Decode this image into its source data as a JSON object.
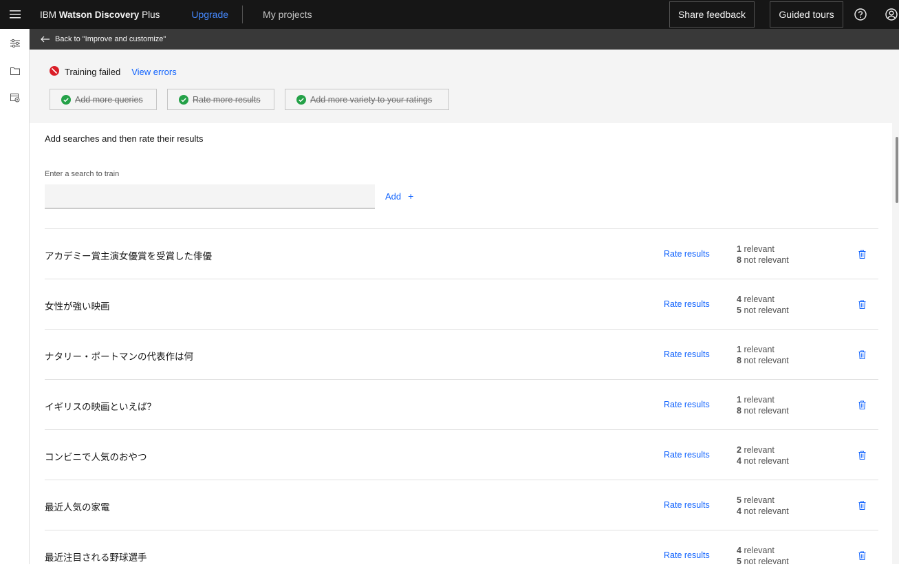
{
  "header": {
    "brand_regular": "IBM ",
    "brand_bold": "Watson Discovery",
    "brand_suffix": " Plus",
    "upgrade": "Upgrade",
    "my_projects": "My projects",
    "share_feedback": "Share feedback",
    "guided_tours": "Guided tours"
  },
  "back_link": "Back to \"Improve and customize\"",
  "status": {
    "label": "Training failed",
    "view_errors": "View errors",
    "color": "#da1e28",
    "tasks": [
      "Add more queries",
      "Rate more results",
      "Add more variety to your ratings"
    ],
    "task_check_color": "#24a148"
  },
  "main": {
    "title": "Add searches and then rate their results",
    "search_label": "Enter a search to train",
    "search_value": "",
    "add_label": "Add",
    "add_symbol": "+",
    "rate_label": "Rate results",
    "relevant_suffix": "relevant",
    "not_relevant_suffix": "not relevant",
    "queries": [
      {
        "text": "アカデミー賞主演女優賞を受賞した俳優",
        "relevant": "1",
        "not_relevant": "8"
      },
      {
        "text": "女性が強い映画",
        "relevant": "4",
        "not_relevant": "5"
      },
      {
        "text": "ナタリー・ポートマンの代表作は何",
        "relevant": "1",
        "not_relevant": "8"
      },
      {
        "text": "イギリスの映画といえば？",
        "relevant": "1",
        "not_relevant": "8"
      },
      {
        "text": "コンビニで人気のおやつ",
        "relevant": "2",
        "not_relevant": "4"
      },
      {
        "text": "最近人気の家電",
        "relevant": "5",
        "not_relevant": "4"
      },
      {
        "text": "最近注目される野球選手",
        "relevant": "4",
        "not_relevant": "5"
      }
    ]
  },
  "colors": {
    "link": "#0f62fe",
    "header_bg": "#161616"
  }
}
